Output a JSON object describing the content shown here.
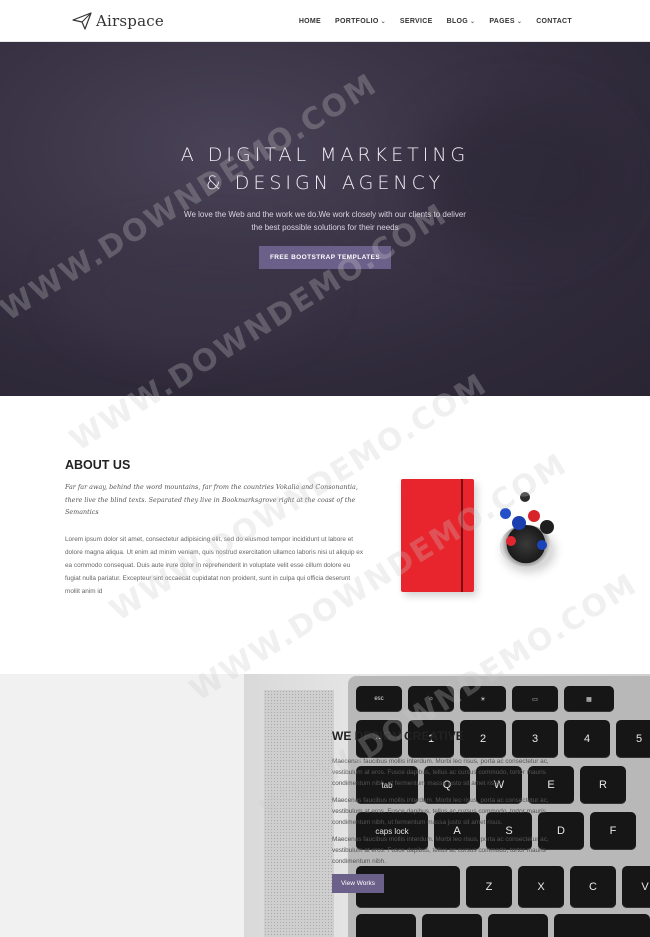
{
  "nav": {
    "logo_text": "Airspace",
    "items": [
      {
        "label": "HOME",
        "dropdown": false
      },
      {
        "label": "PORTFOLIO",
        "dropdown": true
      },
      {
        "label": "SERVICE",
        "dropdown": false
      },
      {
        "label": "BLOG",
        "dropdown": true
      },
      {
        "label": "PAGES",
        "dropdown": true
      },
      {
        "label": "CONTACT",
        "dropdown": false
      }
    ]
  },
  "hero": {
    "title_line1": "A DIGITAL MARKETING",
    "title_line2": "& DESIGN AGENCY",
    "subtitle_line1": "We love the Web and the work we do.We work closely with our clients to deliver",
    "subtitle_line2": "the best possible solutions for their needs",
    "button_label": "FREE BOOTSTRAP TEMPLATES"
  },
  "about": {
    "title": "ABOUT US",
    "intro": "Far far away, behind the word mountains, far from the countries Vokalia and Consonantia, there live the blind texts. Separated they live in Bookmarksgrove right at the coast of the Semantics",
    "body": "Lorem ipsum dolor sit amet, consectetur adipisicing elit, sed do eiusmod tempor incididunt ut labore et dolore magna aliqua. Ut enim ad minim veniam, quis nostrud exercitation ullamco laboris nisi ut aliquip ex ea commodo consequat. Duis aute irure dolor in reprehenderit in voluptate velit esse cillum dolore eu fugiat nulla pariatur. Excepteur sint occaecat cupidatat non proident, sunt in culpa qui officia deserunt mollit anim id"
  },
  "works": {
    "title": "WE DESIGN CREATIVE",
    "p1": "Maecenas faucibus mollis interdum. Morbi leo risus, porta ac consectetur ac, vestibulum at eros. Fusce dapibus, tellus ac cursus commodo, tortor mauris condimentum nibh, ut fermentum massa justo sit amet risus.",
    "p2": "Maecenas faucibus mollis interdum. Morbi leo risus, porta ac consectetur ac, vestibulum at eros. Fusce dapibus, tellus ac cursus commodo, tortor mauris condimentum nibh, ut fermentum massa justo sit amet risus.",
    "p3": "Maecenas faucibus mollis interdum. Morbi leo risus, porta ac consectetur ac, vestibulum at eros. Fusce dapibus, tellus ac cursus commodo, tortor mauris condimentum nibh.",
    "button_label": "View Works",
    "keys": {
      "esc": "esc",
      "f1": "F1",
      "f2": "F2",
      "f3": "F3",
      "f4": "F4",
      "tilde": "~",
      "one": "1",
      "two": "2",
      "three": "3",
      "four": "4",
      "five": "5",
      "excl": "!",
      "at": "@",
      "hash": "#",
      "dollar": "$",
      "pct": "%",
      "tab": "tab",
      "q": "Q",
      "w": "W",
      "e": "E",
      "r": "R",
      "caps": "caps lock",
      "a": "A",
      "s": "S",
      "d": "D",
      "f": "F",
      "shift": "shift",
      "z": "Z",
      "x": "X",
      "c": "C",
      "v": "V"
    }
  },
  "colors": {
    "accent": "#6b6089",
    "hero_bg": "#342e41",
    "notebook": "#e8252c"
  },
  "watermark": "WWW.DOWNDEMO.COM"
}
